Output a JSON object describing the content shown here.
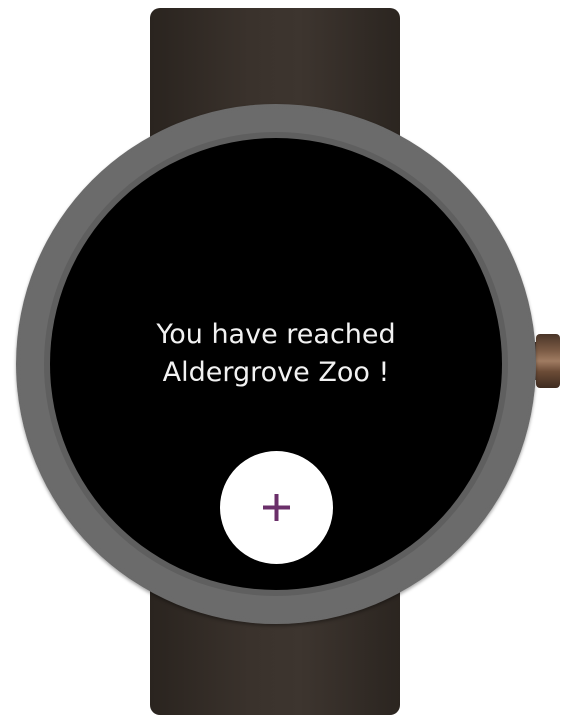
{
  "screen": {
    "message_line_1": "You have reached",
    "message_line_2": "Aldergrove Zoo !"
  },
  "action_button": {
    "icon": "plus-icon",
    "icon_color": "#6b2f6a",
    "background": "#ffffff"
  },
  "colors": {
    "screen_background": "#000000",
    "text": "#f2f2f2",
    "bezel": "#6a6a6a",
    "strap": "#3a322c"
  }
}
